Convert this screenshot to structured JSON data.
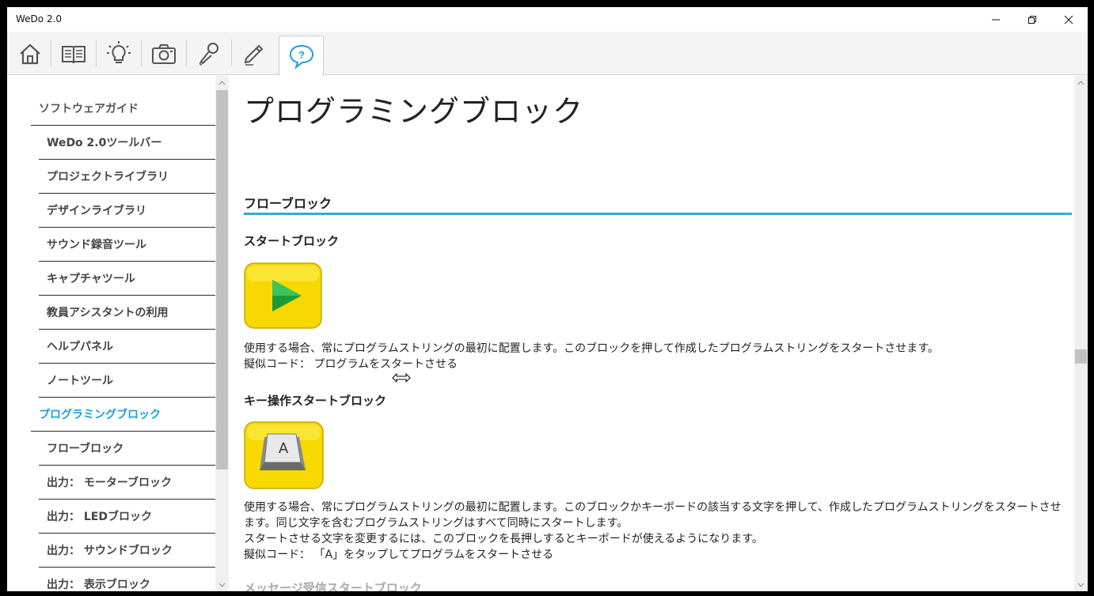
{
  "window": {
    "title": "WeDo 2.0"
  },
  "toolbar": {
    "items": [
      {
        "icon": "home-icon"
      },
      {
        "icon": "book-icon"
      },
      {
        "icon": "lightbulb-icon"
      },
      {
        "icon": "camera-icon"
      },
      {
        "icon": "microphone-icon"
      },
      {
        "icon": "pencil-icon"
      },
      {
        "icon": "help-icon"
      }
    ],
    "active": "help-icon"
  },
  "sidebar": {
    "items": [
      {
        "label": "ソフトウェアガイド",
        "kind": "section"
      },
      {
        "label": "WeDo 2.0ツールバー",
        "kind": "sub"
      },
      {
        "label": "プロジェクトライブラリ",
        "kind": "sub"
      },
      {
        "label": "デザインライブラリ",
        "kind": "sub"
      },
      {
        "label": "サウンド録音ツール",
        "kind": "sub"
      },
      {
        "label": "キャプチャツール",
        "kind": "sub"
      },
      {
        "label": "教員アシスタントの利用",
        "kind": "sub"
      },
      {
        "label": "ヘルプパネル",
        "kind": "sub"
      },
      {
        "label": "ノートツール",
        "kind": "sub"
      },
      {
        "label": "プログラミングブロック",
        "kind": "section",
        "active": true
      },
      {
        "label": "フローブロック",
        "kind": "sub"
      },
      {
        "label": "出力： モーターブロック",
        "kind": "sub"
      },
      {
        "label": "出力： LEDブロック",
        "kind": "sub"
      },
      {
        "label": "出力： サウンドブロック",
        "kind": "sub"
      },
      {
        "label": "出力： 表示ブロック",
        "kind": "sub"
      }
    ]
  },
  "main": {
    "title": "プログラミングブロック",
    "section": "フローブロック",
    "blocks": [
      {
        "title": "スタートブロック",
        "lines": [
          "使用する場合、常にプログラムストリングの最初に配置します。このブロックを押して作成したプログラムストリングをスタートさせます。",
          "擬似コード： プログラムをスタートさせる"
        ]
      },
      {
        "title": "キー操作スタートブロック",
        "key_letter": "A",
        "lines": [
          "使用する場合、常にプログラムストリングの最初に配置します。このブロックかキーボードの該当する文字を押して、作成したプログラムストリングをスタートさせます。同じ文字を含むプログラムストリングはすべて同時にスタートします。",
          "スタートさせる文字を変更するには、このブロックを長押しするとキーボードが使えるようになります。",
          "擬似コード： 「A」をタップしてプログラムをスタートさせる"
        ]
      }
    ],
    "next_block_title": "メッセージ受信スタートブロック"
  },
  "colors": {
    "accent": "#35a9d9",
    "active_nav": "#1aa0d8",
    "block_yellow": "#f7d800"
  }
}
